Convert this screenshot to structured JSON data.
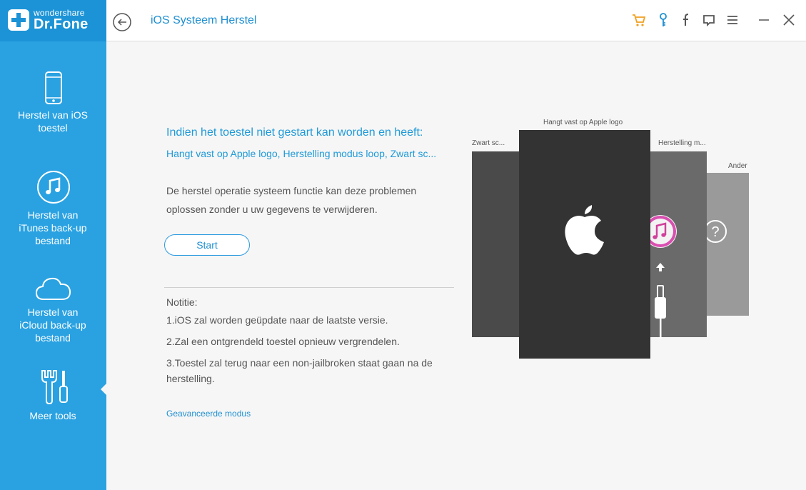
{
  "app": {
    "brand_top": "wondershare",
    "brand_main": "Dr.Fone",
    "title": "iOS Systeem Herstel"
  },
  "sidebar": {
    "items": [
      {
        "label": "Herstel van iOS toestel",
        "icon": "phone-icon"
      },
      {
        "label": "Herstel van iTunes back-up bestand",
        "icon": "music-note-icon"
      },
      {
        "label": "Herstel van iCloud back-up bestand",
        "icon": "cloud-icon"
      },
      {
        "label": "Meer tools",
        "icon": "tools-icon"
      }
    ],
    "active_index": 3
  },
  "header_icons": [
    "cart-icon",
    "key-icon",
    "facebook-icon",
    "feedback-icon",
    "menu-icon",
    "minimize-icon",
    "close-icon"
  ],
  "main": {
    "heading": "Indien het toestel niet gestart kan worden en heeft:",
    "subheading": "Hangt vast op Apple logo, Herstelling modus loop, Zwart sc...",
    "description": "De herstel operatie systeem functie kan deze problemen oplossen zonder u uw gegevens te verwijderen.",
    "start_label": "Start",
    "notes_title": "Notitie:",
    "notes": [
      "1.iOS zal worden geüpdate naar de laatste versie.",
      "2.Zal een ontgrendeld toestel opnieuw vergrendelen.",
      "3.Toestel zal terug naar een non-jailbroken staat gaan na de herstelling."
    ],
    "advanced_label": "Geavanceerde modus"
  },
  "illustration": {
    "labels": {
      "black_screen": "Zwart sc...",
      "apple_logo": "Hangt vast op Apple logo",
      "recovery": "Herstelling m...",
      "other": "Ander"
    }
  },
  "colors": {
    "sidebar": "#2aa2e2",
    "accent": "#1f8fd1",
    "cart": "#f0a020"
  }
}
